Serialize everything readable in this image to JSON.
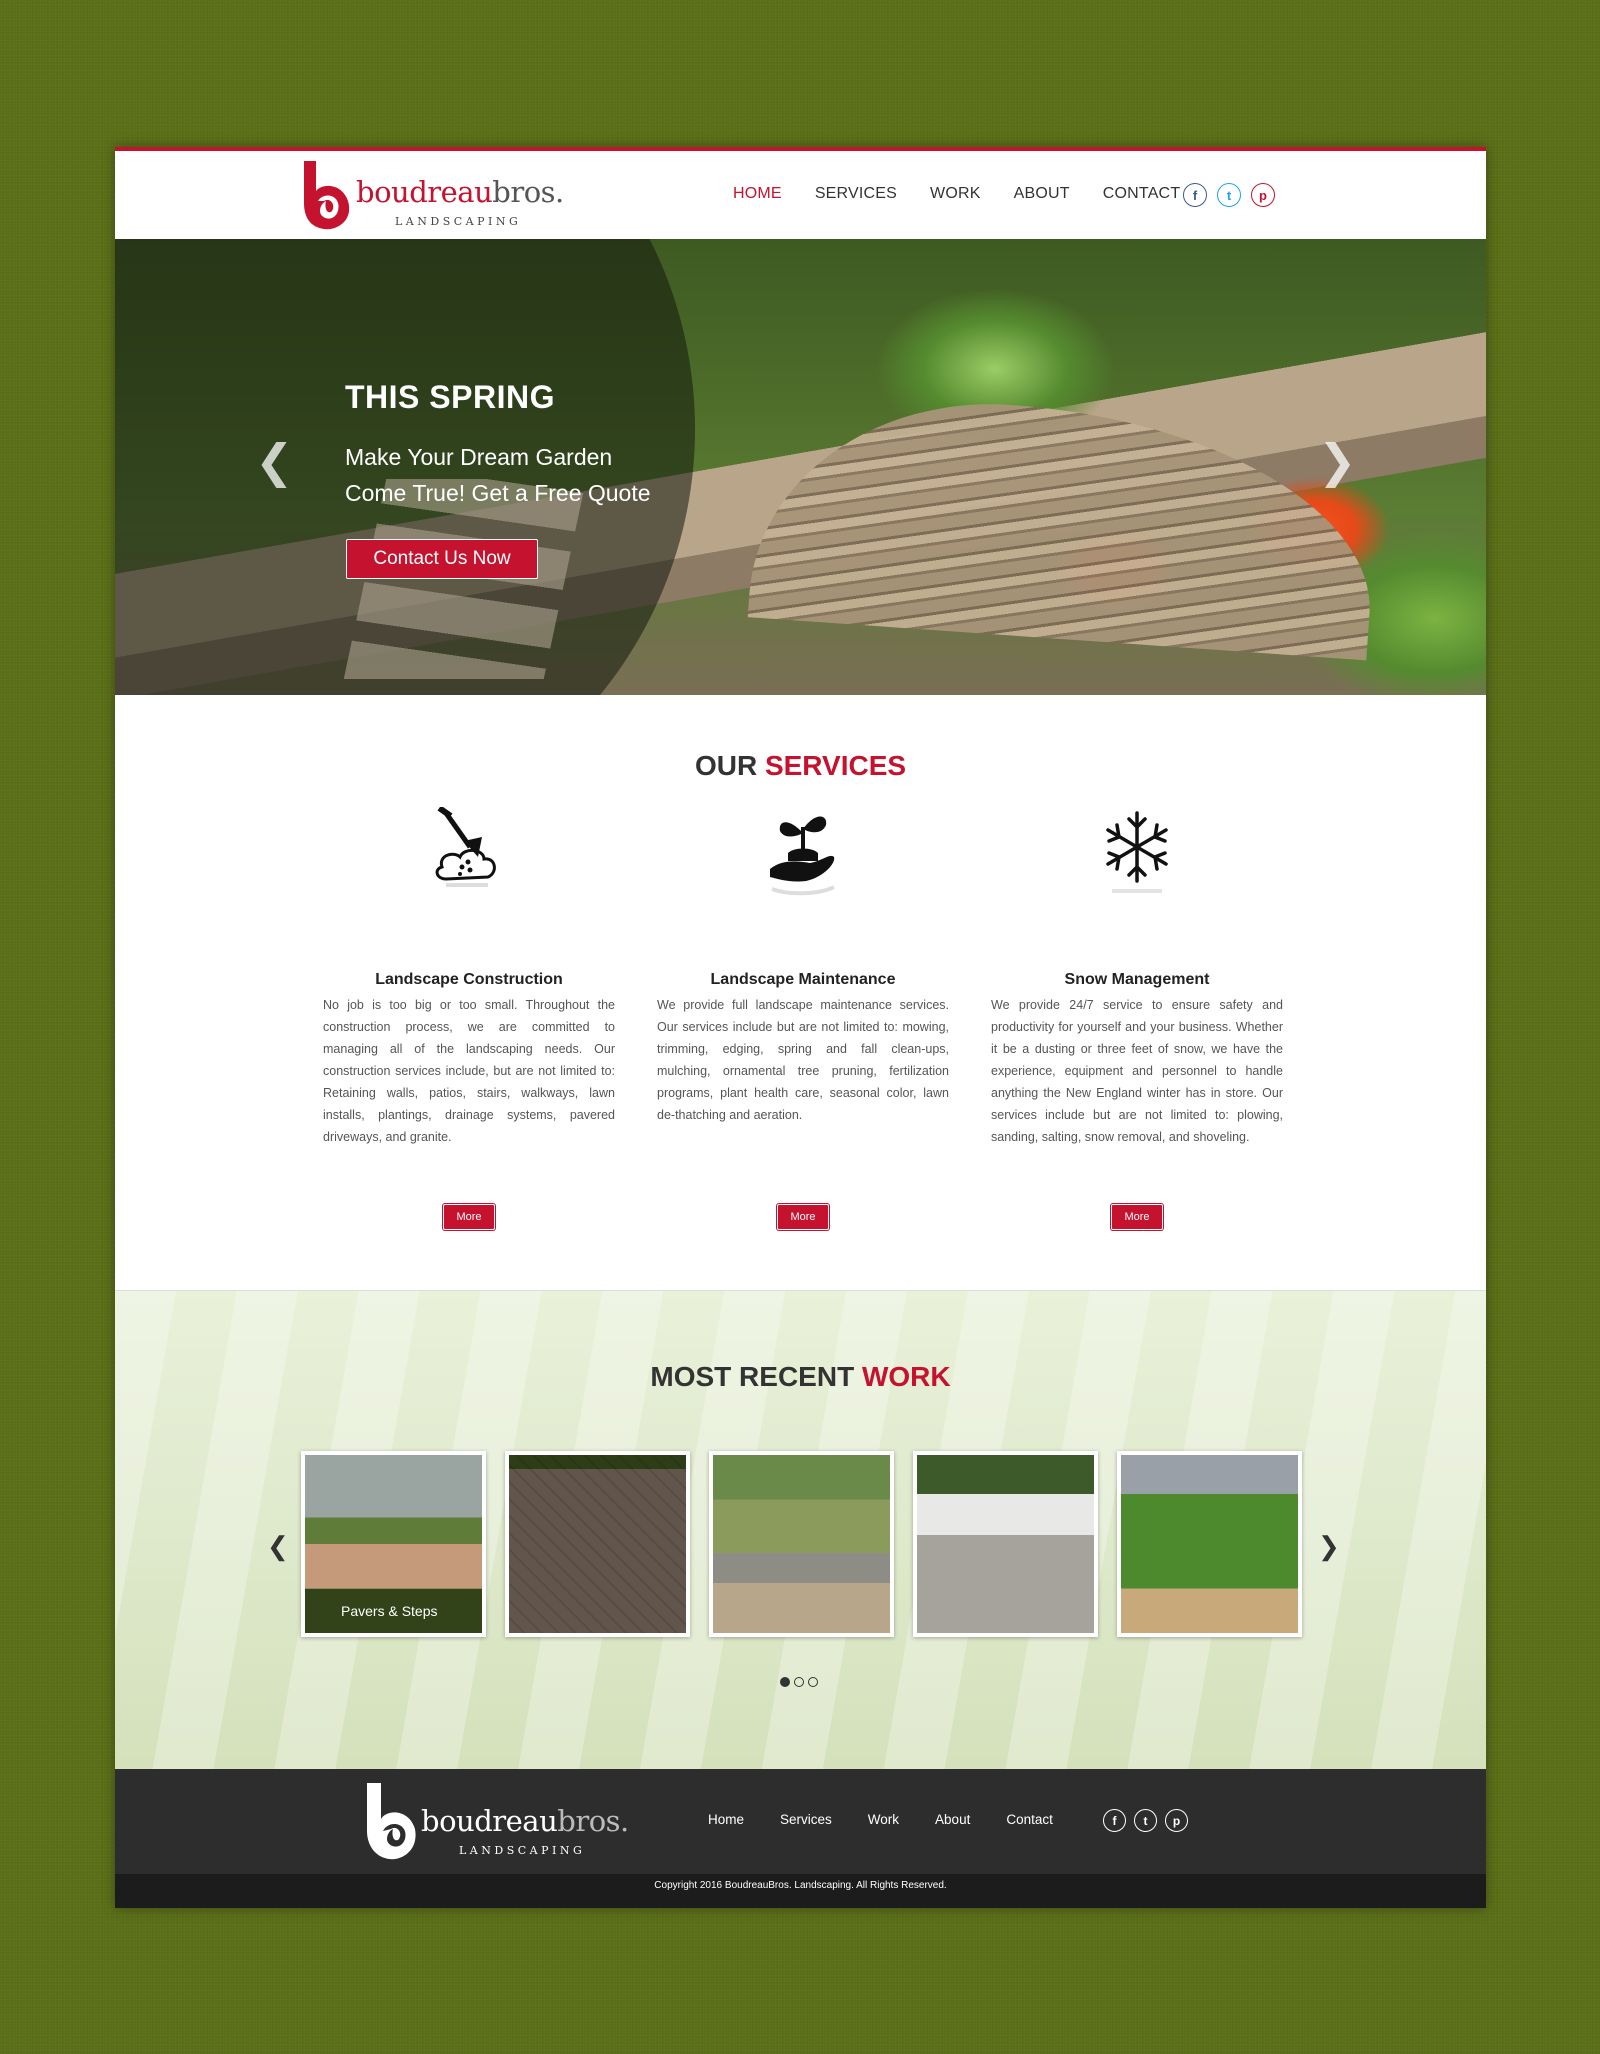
{
  "brand": {
    "name_primary": "boudreau",
    "name_secondary": "bros.",
    "tagline": "LANDSCAPING",
    "color": "#c4122f"
  },
  "nav": {
    "items": [
      {
        "label": "HOME",
        "active": true
      },
      {
        "label": "SERVICES",
        "active": false
      },
      {
        "label": "WORK",
        "active": false
      },
      {
        "label": "ABOUT",
        "active": false
      },
      {
        "label": "CONTACT",
        "active": false
      }
    ]
  },
  "social": {
    "icons": [
      "facebook-icon",
      "twitter-icon",
      "pinterest-icon"
    ],
    "glyphs": [
      "f",
      "t",
      "p"
    ]
  },
  "hero": {
    "title": "THIS SPRING",
    "subtitle": "Make Your Dream Garden Come True! Get a Free Quote",
    "cta": "Contact Us Now",
    "prev": "❮",
    "next": "❯"
  },
  "services": {
    "title_plain": "OUR",
    "title_accent": "SERVICES",
    "items": [
      {
        "icon": "shovel-icon",
        "name": "Landscape Construction",
        "text": "No job is too big or too small. Throughout the construction process, we are committed to managing all of the landscaping needs. Our construction services include, but are not limited to: Retaining walls, patios, stairs, walkways, lawn installs, plantings, drainage systems, pavered driveways, and granite.",
        "more": "More"
      },
      {
        "icon": "plant-in-hand-icon",
        "name": "Landscape Maintenance",
        "text": "We provide full landscape maintenance services. Our services include but are not limited to: mowing, trimming, edging, spring and fall clean-ups, mulching, ornamental tree pruning, fertilization programs, plant health care, seasonal color, lawn de-thatching and aeration.",
        "more": "More"
      },
      {
        "icon": "snowflake-icon",
        "name": "Snow Management",
        "text": "We provide 24/7 service to ensure safety and productivity for yourself and your business. Whether it be a dusting or three feet of snow, we have the experience, equipment and personnel to handle anything the New England winter has in store. Our services include but are not limited to: plowing, sanding, salting, snow removal, and shoveling.",
        "more": "More"
      }
    ]
  },
  "work": {
    "title_plain": "MOST RECENT",
    "title_accent": "WORK",
    "thumbs": [
      {
        "label": "Pavers & Steps"
      },
      {
        "label": ""
      },
      {
        "label": ""
      },
      {
        "label": ""
      },
      {
        "label": ""
      }
    ],
    "prev": "❮",
    "next": "❯",
    "dots": [
      true,
      false,
      false
    ]
  },
  "footer": {
    "nav": [
      "Home",
      "Services",
      "Work",
      "About",
      "Contact"
    ],
    "copyright": "Copyright 2016 BoudreauBros. Landscaping. All Rights Reserved."
  }
}
